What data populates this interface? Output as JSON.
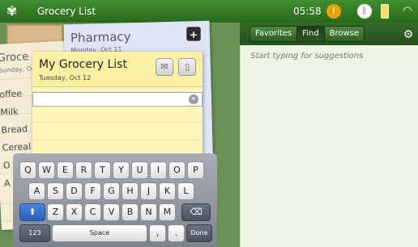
{
  "statusbar": {
    "app_title": "Grocery List",
    "time": "05:58",
    "icons": [
      "app-icon",
      "warning-icon",
      "bluetooth-icon",
      "battery-icon",
      "wifi-icon"
    ]
  },
  "right": {
    "tabs": [
      {
        "label": "Favorites",
        "active": false
      },
      {
        "label": "Find",
        "active": true
      },
      {
        "label": "Browse",
        "active": false
      }
    ],
    "hint": "Start typing for suggestions"
  },
  "notes": {
    "back_list": {
      "title": "Groce",
      "date": "Sunday, Oc",
      "items": [
        "offee",
        "Milk",
        "Bread",
        "Cereal",
        "O",
        "A"
      ]
    },
    "pharmacy": {
      "title": "Pharmacy",
      "date": "Monday, Oct 11"
    },
    "main": {
      "title": "My Grocery List",
      "date": "Tuesday, Oct 12",
      "input_value": ""
    }
  },
  "keyboard": {
    "row1": [
      "Q",
      "W",
      "E",
      "R",
      "T",
      "Y",
      "U",
      "I",
      "O",
      "P"
    ],
    "row2": [
      "A",
      "S",
      "D",
      "F",
      "G",
      "H",
      "J",
      "K",
      "L"
    ],
    "row3": [
      "Z",
      "X",
      "C",
      "V",
      "B",
      "N",
      "M"
    ],
    "numbers_label": "123",
    "space_label": "Space",
    "comma_label": ",",
    "period_label": ".",
    "done_label": "Done"
  },
  "colors": {
    "statusbar": "#2a6a1e",
    "note_yellow": "#fef6b8",
    "panel": "#ecf6e2"
  }
}
